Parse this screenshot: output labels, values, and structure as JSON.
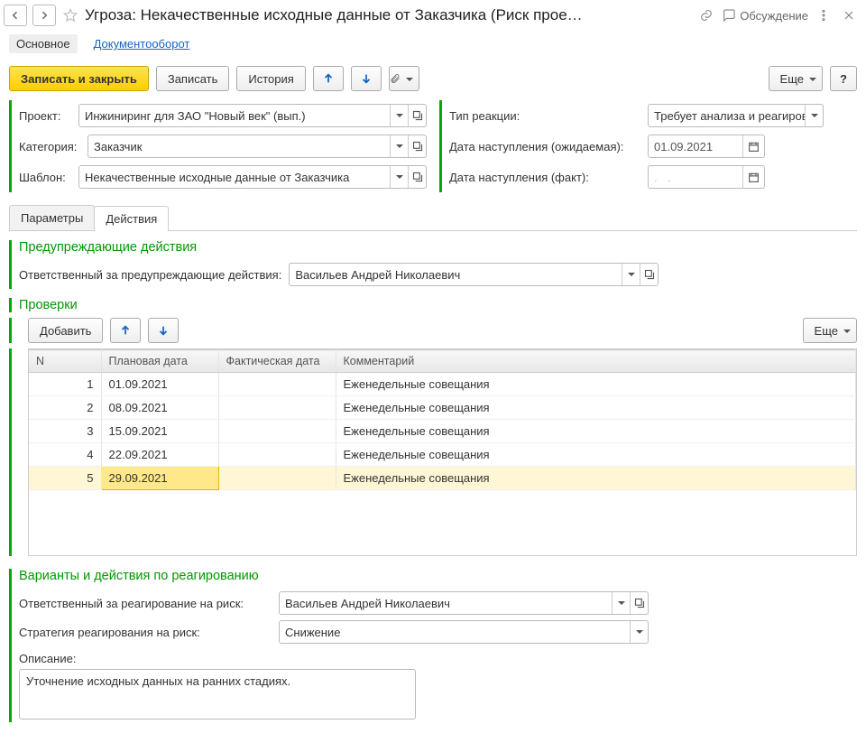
{
  "header": {
    "title": "Угроза: Некачественные исходные данные от Заказчика (Риск прое…",
    "discussion": "Обсуждение"
  },
  "nav": {
    "main": "Основное",
    "docflow": "Документооборот"
  },
  "toolbar": {
    "save_close": "Записать и закрыть",
    "save": "Записать",
    "history": "История",
    "more": "Еще"
  },
  "form": {
    "project_label": "Проект:",
    "project_value": "Инжиниринг для ЗАО \"Новый век\" (вып.)",
    "category_label": "Категория:",
    "category_value": "Заказчик",
    "template_label": "Шаблон:",
    "template_value": "Некачественные исходные данные от Заказчика",
    "reaction_type_label": "Тип реакции:",
    "reaction_type_value": "Требует анализа и реагирова",
    "date_expected_label": "Дата наступления (ожидаемая):",
    "date_expected_value": "01.09.2021",
    "date_fact_label": "Дата наступления (факт):",
    "date_fact_value": ".  ."
  },
  "tabs": {
    "params": "Параметры",
    "actions": "Действия"
  },
  "preventive": {
    "heading": "Предупреждающие действия",
    "resp_label": "Ответственный за предупреждающие действия:",
    "resp_value": "Васильев Андрей Николаевич"
  },
  "checks": {
    "heading": "Проверки",
    "add": "Добавить",
    "more": "Еще",
    "columns": {
      "n": "N",
      "plan": "Плановая дата",
      "fact": "Фактическая дата",
      "comment": "Комментарий"
    },
    "rows": [
      {
        "n": "1",
        "plan": "01.09.2021",
        "fact": "",
        "comment": "Еженедельные совещания"
      },
      {
        "n": "2",
        "plan": "08.09.2021",
        "fact": "",
        "comment": "Еженедельные совещания"
      },
      {
        "n": "3",
        "plan": "15.09.2021",
        "fact": "",
        "comment": "Еженедельные совещания"
      },
      {
        "n": "4",
        "plan": "22.09.2021",
        "fact": "",
        "comment": "Еженедельные совещания"
      },
      {
        "n": "5",
        "plan": "29.09.2021",
        "fact": "",
        "comment": "Еженедельные совещания"
      }
    ],
    "selected_row_index": 4
  },
  "response": {
    "heading": "Варианты и действия по реагированию",
    "resp_label": "Ответственный за реагирование на риск:",
    "resp_value": "Васильев Андрей Николаевич",
    "strategy_label": "Стратегия реагирования на риск:",
    "strategy_value": "Снижение",
    "desc_label": "Описание:",
    "desc_value": "Уточнение исходных данных на ранних стадиях."
  }
}
